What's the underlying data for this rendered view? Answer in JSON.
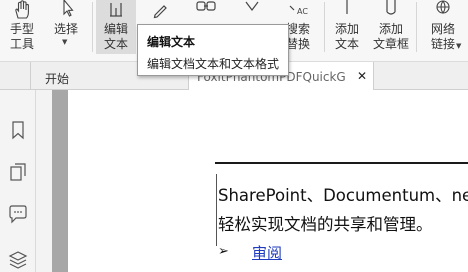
{
  "ribbon": {
    "hand_tool": {
      "line1": "手型",
      "line2": "工具"
    },
    "select": {
      "line1": "选择"
    },
    "edit_text": {
      "line1": "编辑",
      "line2": "文本"
    },
    "search_replace": {
      "line1": "搜索",
      "line2": "替换"
    },
    "add_text": {
      "line1": "添加",
      "line2": "文本"
    },
    "add_textbox": {
      "line1": "添加",
      "line2": "文章框"
    },
    "web_link": {
      "line1": "网络",
      "line2": "链接"
    }
  },
  "tooltip": {
    "title": "编辑文本",
    "description": "编辑文档文本和文本格式"
  },
  "tabs": {
    "home": "开始",
    "document": "FoxitPhantomPDFQuickG...",
    "close": "✕"
  },
  "document": {
    "line1": "SharePoint、Documentum、ne",
    "line2": "轻松实现文档的共享和管理。",
    "bullet": "➢",
    "link": "审阅"
  },
  "colors": {
    "ribbon_bg": "#f7f7f7",
    "active_button": "#dcdcdc",
    "link": "#1f3bbf",
    "page_edge": "#a7a7a7"
  },
  "icons": [
    "hand-icon",
    "select-arrow-icon",
    "edit-text-icon",
    "edit-object-icon",
    "link-icon",
    "shape-icon",
    "search-replace-icon",
    "add-text-icon",
    "add-textbox-icon",
    "web-link-icon",
    "bookmark-icon",
    "pages-icon",
    "comment-icon",
    "layers-icon"
  ]
}
